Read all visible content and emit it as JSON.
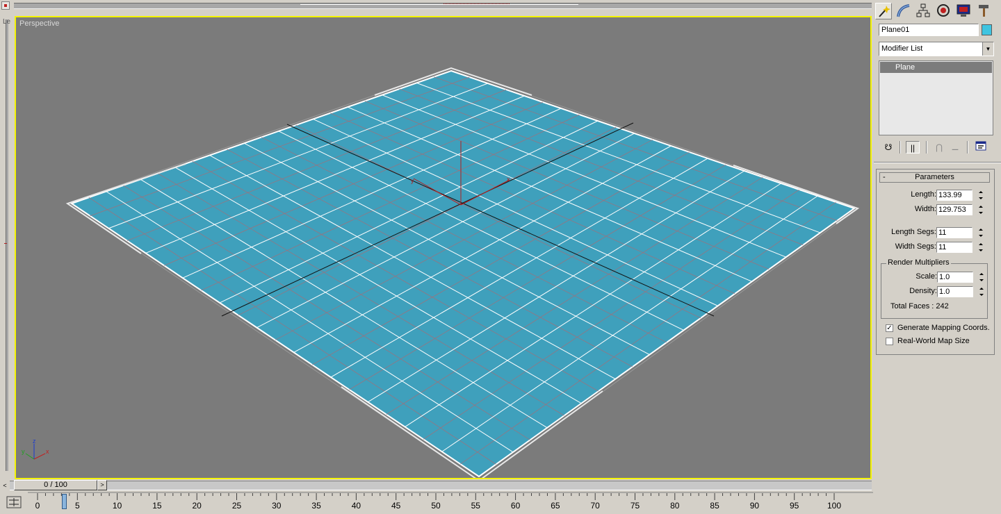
{
  "viewport": {
    "label": "Perspective",
    "left_label": "Le",
    "axis_labels": {
      "x": "x",
      "y": "y",
      "z": "z"
    },
    "object_color": "#3fa0bc",
    "selection_color": "#f4f400",
    "background_color": "#7b7b7b"
  },
  "command_panel": {
    "tabs": [
      {
        "name": "create-tab",
        "icon": "magic-wand-icon",
        "active": true
      },
      {
        "name": "modify-tab",
        "icon": "bend-icon",
        "active": false
      },
      {
        "name": "hierarchy-tab",
        "icon": "hierarchy-icon",
        "active": false
      },
      {
        "name": "motion-tab",
        "icon": "motion-icon",
        "active": false
      },
      {
        "name": "display-tab",
        "icon": "monitor-icon",
        "active": false
      },
      {
        "name": "utilities-tab",
        "icon": "hammer-icon",
        "active": false
      }
    ],
    "object_name": "Plane01",
    "object_color": "#3fc4e0",
    "modifier_list": "Modifier List",
    "stack_items": [
      "Plane"
    ],
    "stack_tools": [
      "pin-stack-icon",
      "show-end-result-icon",
      "make-unique-icon",
      "remove-modifier-icon",
      "configure-sets-icon"
    ],
    "parameters": {
      "title": "Parameters",
      "collapse_symbol": "-",
      "length_label": "Length:",
      "length_value": "133.99",
      "width_label": "Width:",
      "width_value": "129.753",
      "length_segs_label": "Length Segs:",
      "length_segs_value": "11",
      "width_segs_label": "Width Segs:",
      "width_segs_value": "11",
      "render_group_title": "Render Multipliers",
      "scale_label": "Scale:",
      "scale_value": "1.0",
      "density_label": "Density:",
      "density_value": "1.0",
      "total_faces": "Total Faces : 242",
      "generate_mapping_label": "Generate Mapping Coords.",
      "generate_mapping_checked": true,
      "real_world_label": "Real-World Map Size",
      "real_world_checked": false
    }
  },
  "time_slider": {
    "frame_text": "0 / 100",
    "prev_symbol": "<",
    "next_symbol": ">"
  },
  "track_bar": {
    "ticks": [
      "0",
      "5",
      "10",
      "15",
      "20",
      "25",
      "30",
      "35",
      "40",
      "45",
      "50",
      "55",
      "60",
      "65",
      "70",
      "75",
      "80",
      "85",
      "90",
      "95",
      "100"
    ]
  }
}
